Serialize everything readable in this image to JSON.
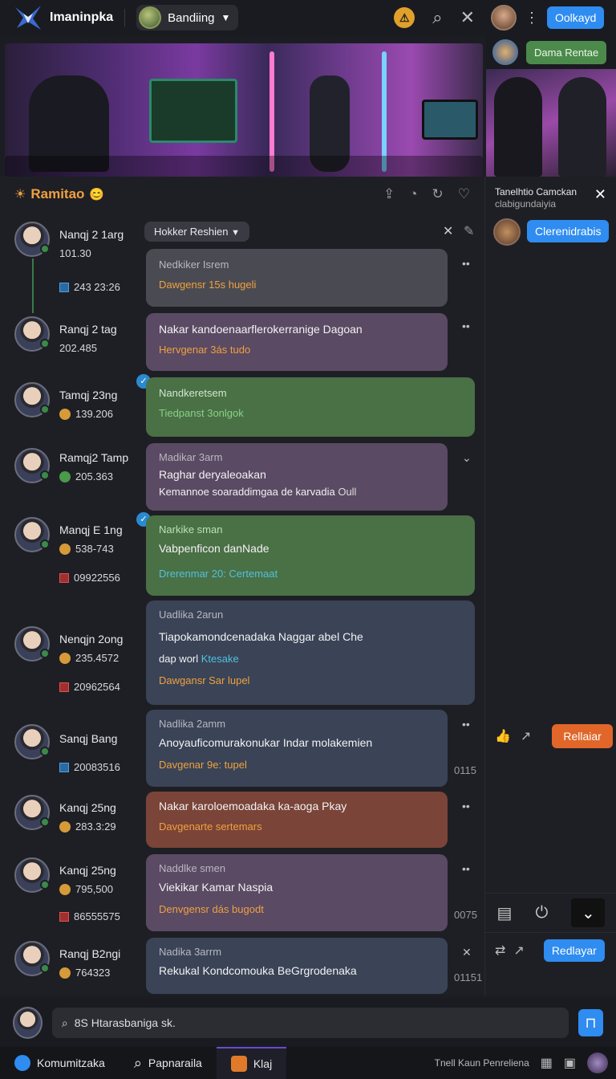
{
  "app": {
    "name": "Imaninpka",
    "channel": "Bandiing"
  },
  "top_right": {
    "primary_button": "Oolkayd",
    "secondary_button": "Dama Rentae"
  },
  "section": {
    "title": "Ramitao"
  },
  "filter_pill": "Hokker Reshien",
  "posts": [
    {
      "user": "Nanqj 2 1arg",
      "stat1": "101.30",
      "stat2": "243 23:26",
      "header": "Nedkiker Isrem",
      "text": "",
      "footer": "Dawgensr 15s hugeli",
      "style": "grey"
    },
    {
      "user": "Ranqj 2 tag",
      "stat1": "202.485",
      "stat2": "",
      "header": "",
      "text": "Nakar kandoenaarflerokerranige Dagoan",
      "footer": "Hervgenar 3ás tudo",
      "style": "purple"
    },
    {
      "user": "Tamqj 23ng",
      "stat1": "139.206",
      "stat2": "",
      "header": "Nandkeretsem",
      "text": "",
      "footer": "Tiedpanst 3onlgok",
      "style": "green"
    },
    {
      "user": "Ramqj2 Tamp",
      "stat1": "205.363",
      "stat2": "",
      "header": "Madikar 3arm",
      "text": "Raghar deryaleoakan",
      "text2": "Kemannoe soaraddimgaa de karvadia",
      "footer": "Oull",
      "style": "purple"
    },
    {
      "user": "Manqj E 1ng",
      "stat1": "538-743",
      "stat2": "09922556",
      "header": "Narkike sman",
      "text": "Vabpenficon danNade",
      "footer": "Drerenmar 20: Certemaat",
      "style": "green"
    },
    {
      "user": "Nenqjn 2ong",
      "stat1": "235.4572",
      "stat2": "20962564",
      "header": "Uadlika 2arun",
      "text": "Tiapokamondcenadaka Naggar abel Che",
      "text2": "dap worl",
      "text2b": "Ktesake",
      "footer": "Dawgansr Sar lupel",
      "style": "slate"
    },
    {
      "user": "Sanqj Bang",
      "stat1": "20083516",
      "stat2": "",
      "header": "Nadlika 2amm",
      "text": "Anoyauficomurakonukar Indar molakemien",
      "footer": "Davgenar 9e: tupel",
      "style": "slate",
      "tail": "0115"
    },
    {
      "user": "Kanqj 25ng",
      "stat1": "283.3:29",
      "stat2": "",
      "header": "",
      "text": "Nakar karoloemoadaka ka-aoga Pkay",
      "footer": "Davgenarte sertemars",
      "style": "red"
    },
    {
      "user": "Kanqj 25ng",
      "stat1": "795,500",
      "stat2": "86555575",
      "header": "Naddlke smen",
      "text": "Viekikar Kamar Naspia",
      "footer": "Denvgensr dás bugodt",
      "style": "purple",
      "tail": "0075"
    },
    {
      "user": "Ranqj B2ngi",
      "stat1": "764323",
      "stat2": "",
      "header": "Nadika 3arrm",
      "text": "Rekukal Kondcomouka BeGrgrodenaka",
      "footer": "",
      "style": "slate",
      "tail": "01151"
    }
  ],
  "right_panel": {
    "title_line1": "Tanelhtio Camckan",
    "title_line2": "clabigundaiyia",
    "button": "Clerenidrabis",
    "react_button": "Rellaiar",
    "reply_button": "Redlayar"
  },
  "composer": {
    "placeholder": "8S Htarasbaniga sk."
  },
  "nav": {
    "item1": "Komumitzaka",
    "item2": "Papnaraila",
    "item3": "Klaj",
    "right_text": "Tnell Kaun Penreliena"
  },
  "colors": {
    "accent": "#2f8cf0",
    "warning": "#f0a040",
    "orange": "#e0662a",
    "green": "#4a7045"
  }
}
